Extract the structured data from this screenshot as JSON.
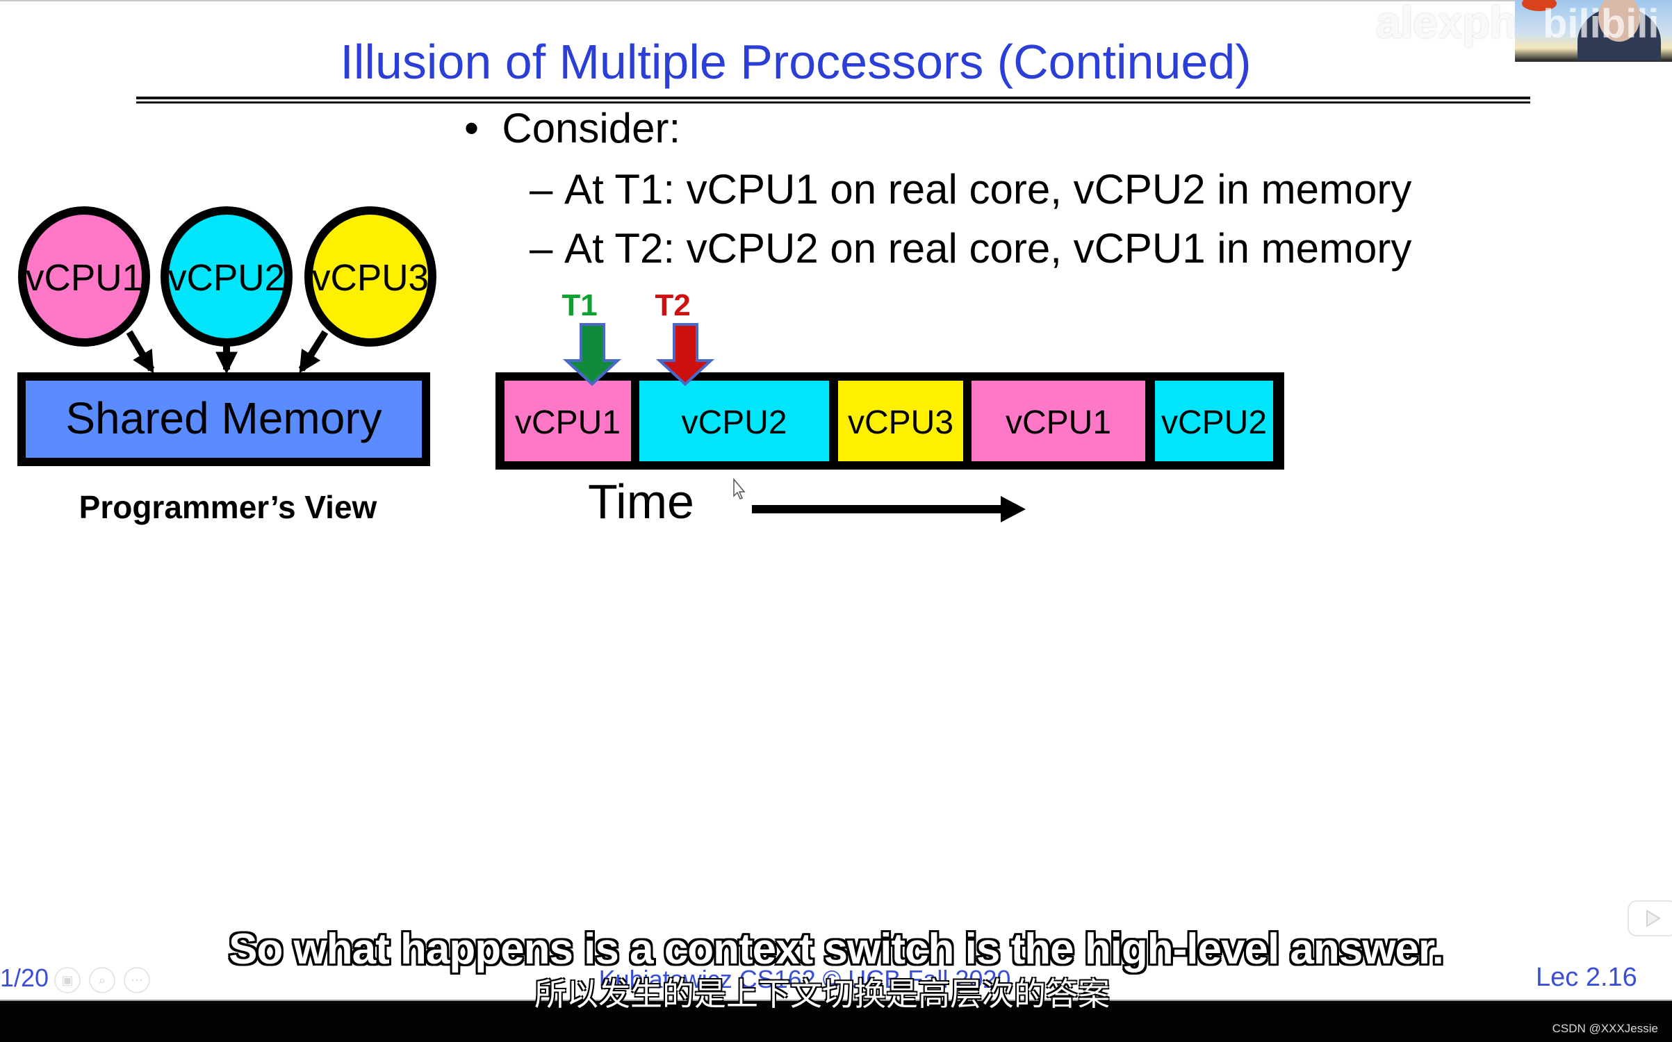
{
  "slide": {
    "title": "Illusion of Multiple Processors (Continued)",
    "bullets": {
      "main": {
        "marker": "•",
        "text": "Consider:"
      },
      "subs": [
        {
          "marker": "–",
          "text": "At T1: vCPU1 on real core, vCPU2 in memory"
        },
        {
          "marker": "–",
          "text": "At T2: vCPU2 on real core, vCPU1 in memory"
        }
      ]
    },
    "programmers_view": {
      "vcpus": [
        {
          "label": "vCPU1",
          "color": "#ff78c8"
        },
        {
          "label": "vCPU2",
          "color": "#00e5fa"
        },
        {
          "label": "vCPU3",
          "color": "#fff000"
        }
      ],
      "memory_label": "Shared Memory",
      "memory_color": "#5b8cff",
      "caption": "Programmer’s View"
    },
    "timeline": {
      "segments": [
        {
          "label": "vCPU1",
          "color": "#ff78c8"
        },
        {
          "label": "vCPU2",
          "color": "#00e5fa"
        },
        {
          "label": "vCPU3",
          "color": "#fff000"
        },
        {
          "label": "vCPU1",
          "color": "#ff78c8"
        },
        {
          "label": "vCPU2",
          "color": "#00e5fa"
        }
      ],
      "markers": [
        {
          "label": "T1",
          "color": "#10a030",
          "arrow_color": "#128a3c",
          "segment_index": 0
        },
        {
          "label": "T2",
          "color": "#d01010",
          "arrow_color": "#cc1010",
          "segment_index": 1
        }
      ],
      "time_label": "Time"
    },
    "footer": {
      "page": "1/20",
      "credit": "Kubiatowicz CS162 © UCB Fall 2020",
      "lecture": "Lec 2.16",
      "icons": [
        "thumbnails-icon",
        "zoom-icon",
        "more-icon"
      ]
    }
  },
  "video": {
    "watermark": "alexphil",
    "platform_logo": "bilibili",
    "subtitle_en": "So what happens is a context switch is the high-level answer.",
    "subtitle_zh": "所以发生的是上下文切换是高层次的答案",
    "credit": "CSDN @XXXJessie"
  }
}
